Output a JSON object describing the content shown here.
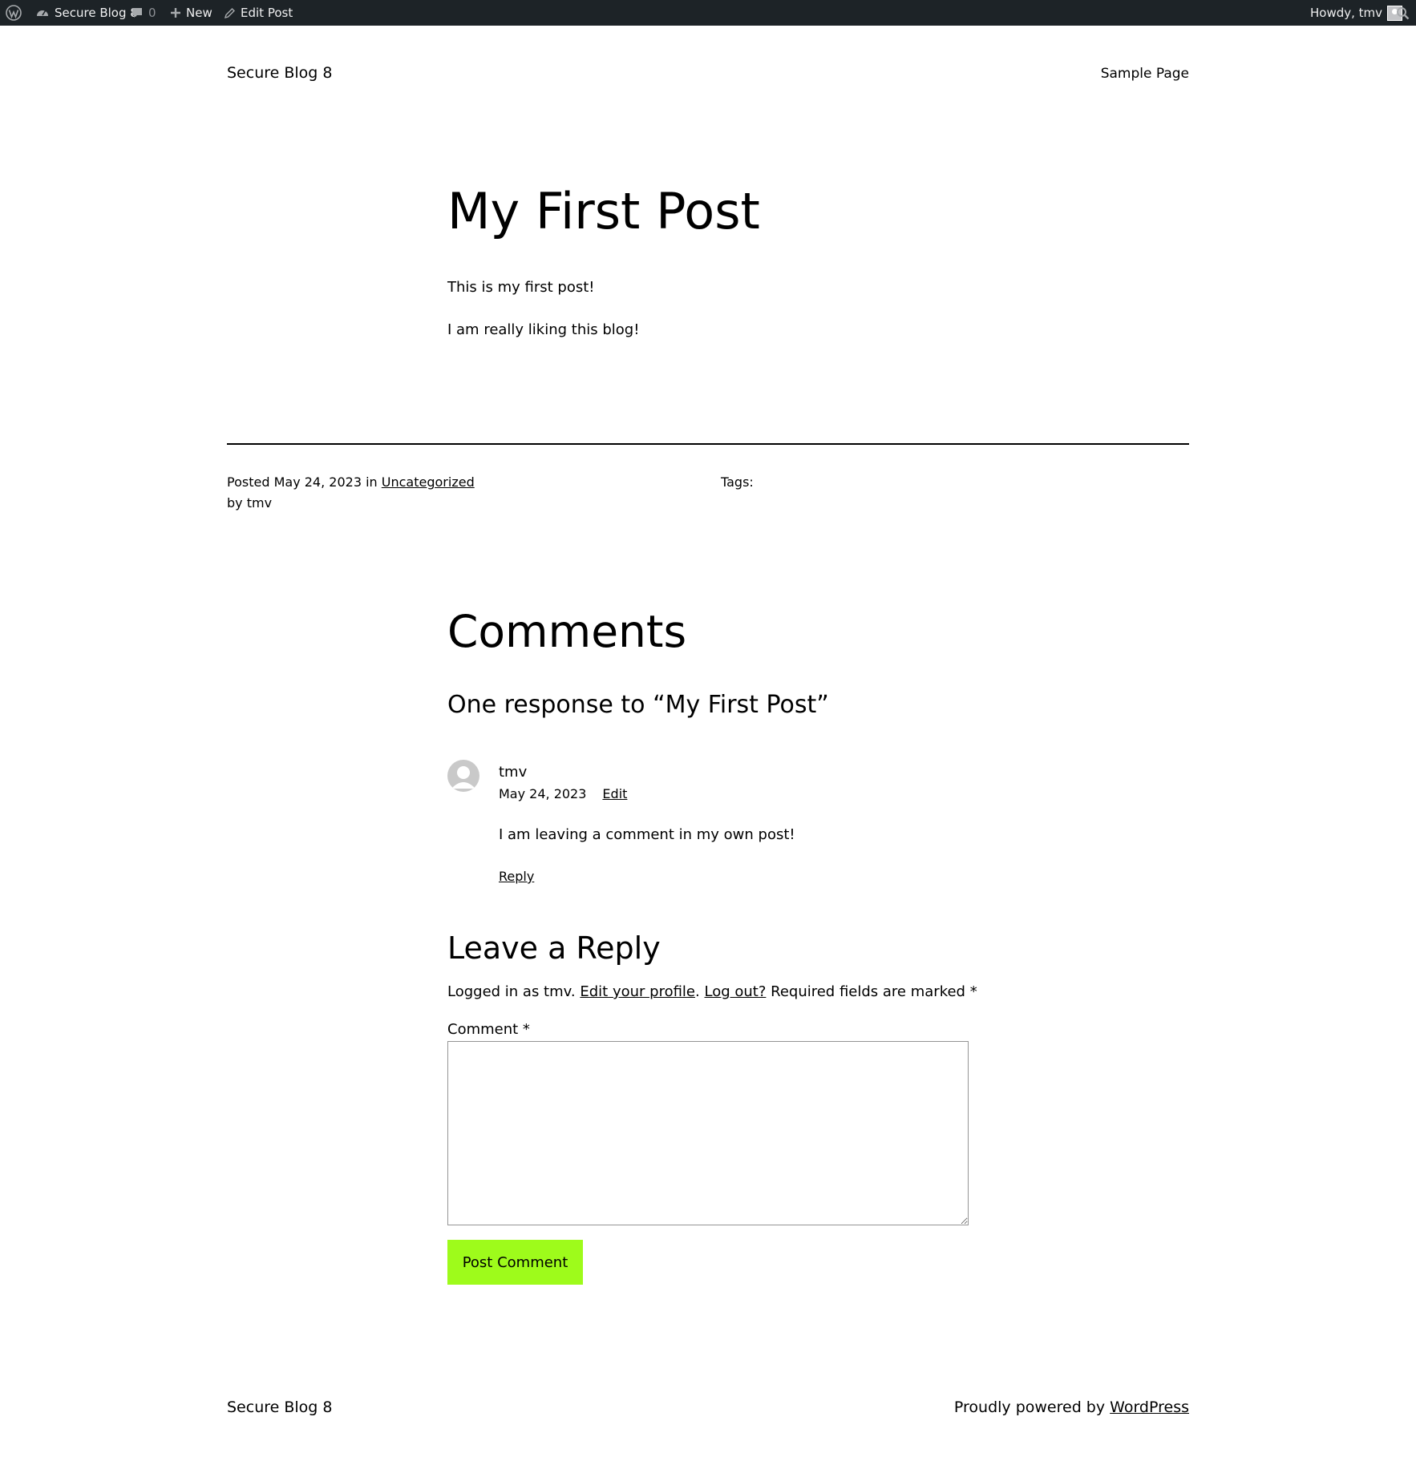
{
  "admin_bar": {
    "site_name": "Secure Blog 8",
    "comments_count": "0",
    "new_label": "New",
    "edit_post_label": "Edit Post",
    "howdy_text": "Howdy, tmv"
  },
  "header": {
    "site_title": "Secure Blog 8",
    "nav_sample_page": "Sample Page"
  },
  "post": {
    "title": "My First Post",
    "paragraphs": [
      "This is my first post!",
      "I am really liking this blog!"
    ],
    "meta": {
      "posted_prefix": "Posted",
      "date": "May 24, 2023",
      "in_text": "in",
      "category": "Uncategorized",
      "by_prefix": "by",
      "author": "tmv",
      "tags_label": "Tags:"
    }
  },
  "comments": {
    "heading": "Comments",
    "responses_title": "One response to “My First Post”",
    "items": [
      {
        "author": "tmv",
        "date": "May 24, 2023",
        "edit_label": "Edit",
        "text": "I am leaving a comment in my own post!",
        "reply_label": "Reply"
      }
    ]
  },
  "reply_form": {
    "title": "Leave a Reply",
    "logged_in_prefix": "Logged in as tmv.",
    "edit_profile": "Edit your profile",
    "period": ".",
    "log_out": "Log out?",
    "required_text": "Required fields are marked *",
    "comment_label": "Comment *",
    "comment_value": "",
    "submit_label": "Post Comment"
  },
  "footer": {
    "site_title": "Secure Blog 8",
    "powered_prefix": "Proudly powered by",
    "powered_link": "WordPress"
  },
  "colors": {
    "admin_bar_bg": "#1d2327",
    "button_bg": "#9efb1b",
    "text": "#000000"
  }
}
